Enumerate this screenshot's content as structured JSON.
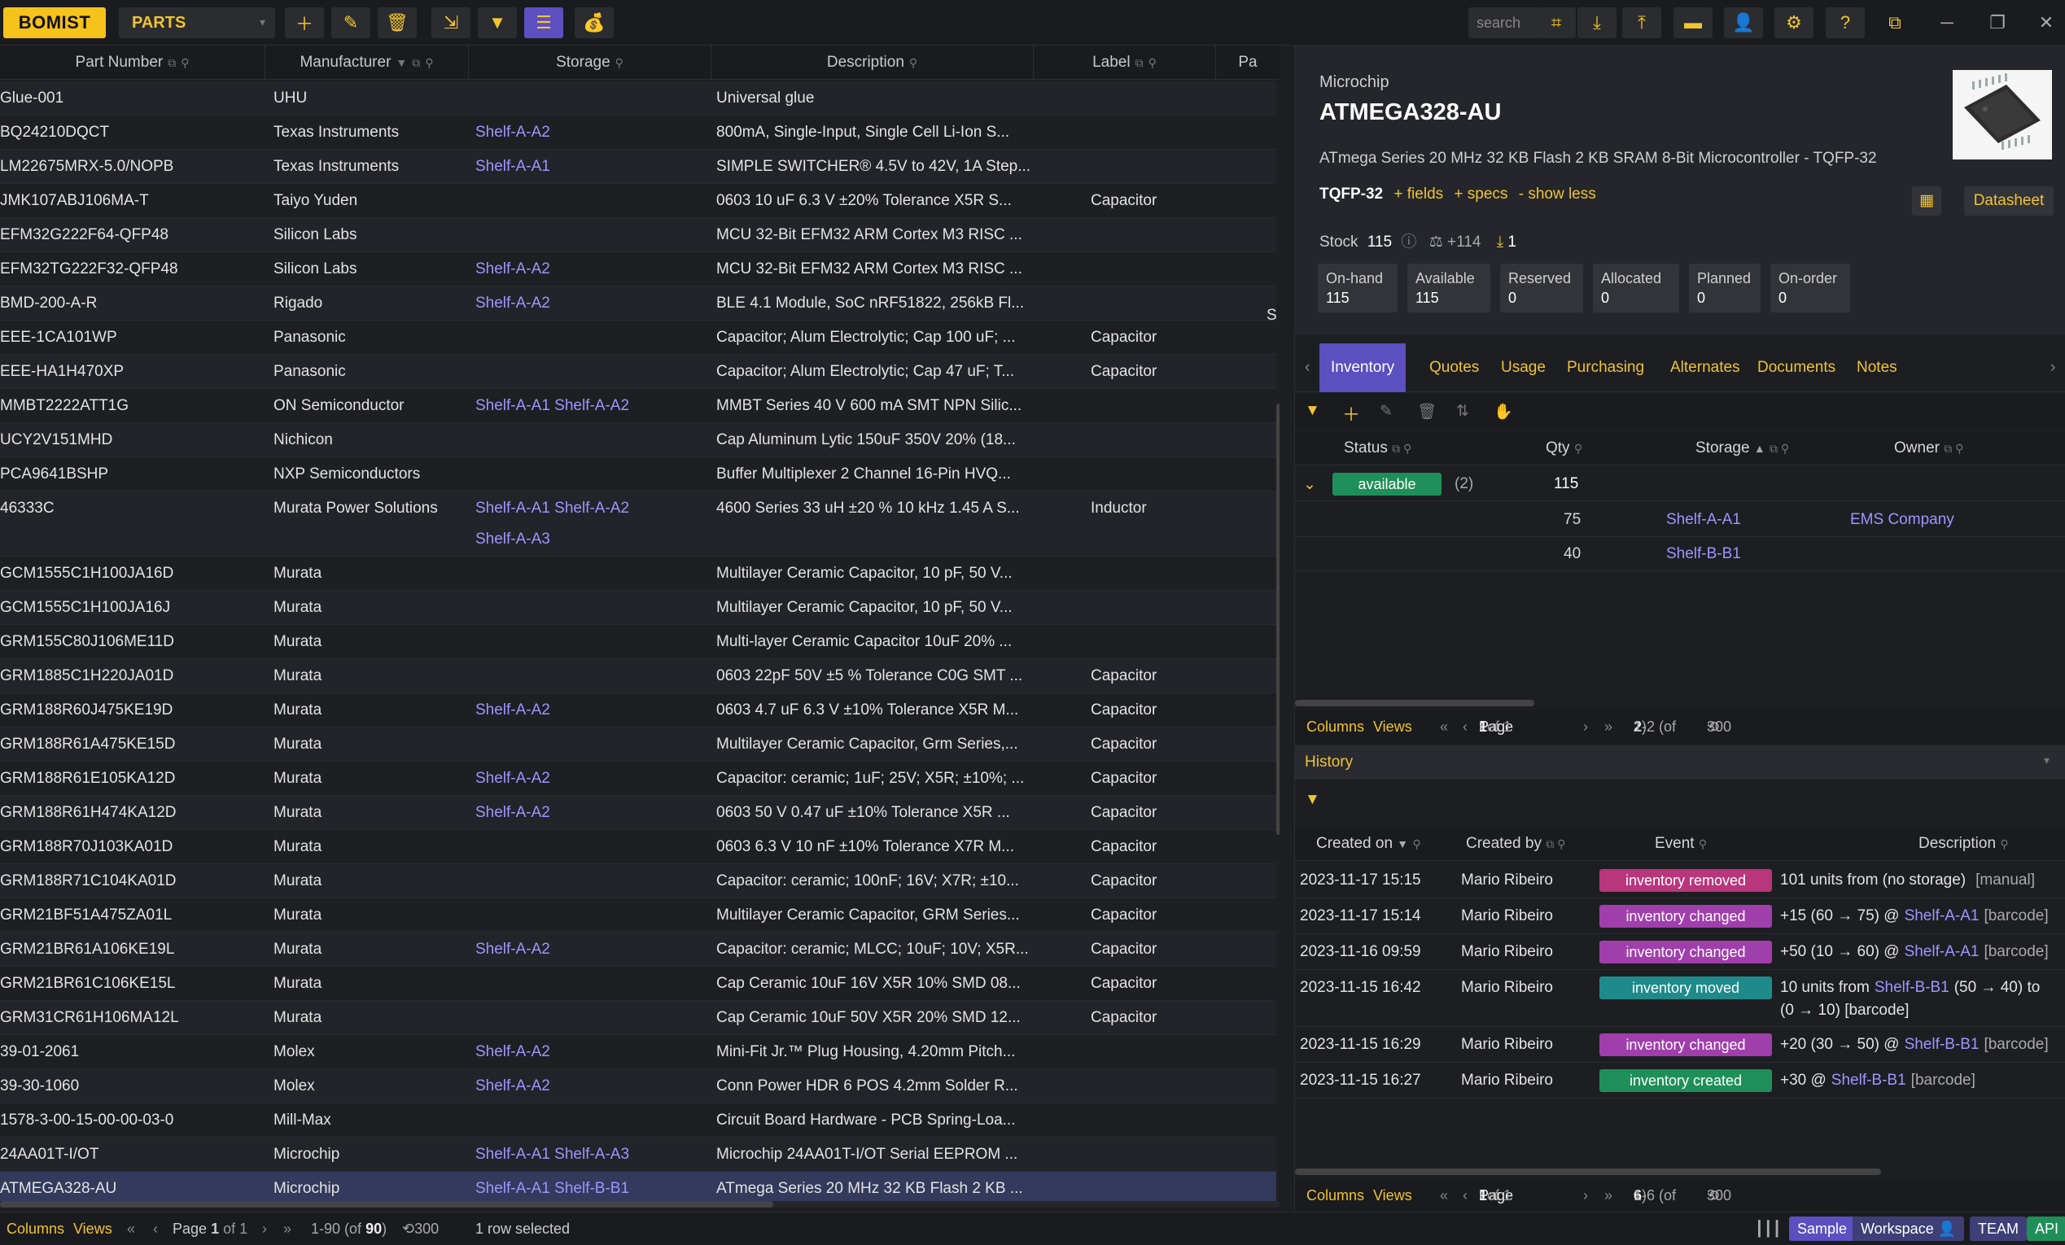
{
  "app": {
    "logo": "BOMIST",
    "module": "PARTS",
    "search_placeholder": "search"
  },
  "grid": {
    "columns": [
      "Part Number",
      "Manufacturer",
      "Storage",
      "Description",
      "Label",
      "Pa"
    ],
    "rows": [
      {
        "pn": "Glue-001",
        "mf": "UHU",
        "st": "",
        "de": "Universal glue",
        "lb": ""
      },
      {
        "pn": "BQ24210DQCT",
        "mf": "Texas Instruments",
        "st": "Shelf-A-A2",
        "de": "800mA, Single-Input, Single Cell Li-Ion S...",
        "lb": ""
      },
      {
        "pn": "LM22675MRX-5.0/NOPB",
        "mf": "Texas Instruments",
        "st": "Shelf-A-A1",
        "de": "SIMPLE SWITCHER® 4.5V to 42V, 1A Step...",
        "lb": ""
      },
      {
        "pn": "JMK107ABJ106MA-T",
        "mf": "Taiyo Yuden",
        "st": "",
        "de": "0603 10 uF 6.3 V ±20% Tolerance X5R S...",
        "lb": "Capacitor"
      },
      {
        "pn": "EFM32G222F64-QFP48",
        "mf": "Silicon Labs",
        "st": "",
        "de": "MCU 32-Bit EFM32 ARM Cortex M3 RISC ...",
        "lb": ""
      },
      {
        "pn": "EFM32TG222F32-QFP48",
        "mf": "Silicon Labs",
        "st": "Shelf-A-A2",
        "de": "MCU 32-Bit EFM32 ARM Cortex M3 RISC ...",
        "lb": ""
      },
      {
        "pn": "BMD-200-A-R",
        "mf": "Rigado",
        "st": "Shelf-A-A2",
        "de": "BLE 4.1 Module, SoC nRF51822, 256kB Fl...",
        "lb": ""
      },
      {
        "pn": "EEE-1CA101WP",
        "mf": "Panasonic",
        "st": "",
        "de": "Capacitor; Alum Electrolytic; Cap 100 uF; ...",
        "lb": "Capacitor"
      },
      {
        "pn": "EEE-HA1H470XP",
        "mf": "Panasonic",
        "st": "",
        "de": "Capacitor; Alum Electrolytic; Cap 47 uF; T...",
        "lb": "Capacitor"
      },
      {
        "pn": "MMBT2222ATT1G",
        "mf": "ON Semiconductor",
        "st": "Shelf-A-A1  Shelf-A-A2",
        "de": "MMBT Series 40 V 600 mA SMT NPN Silic...",
        "lb": ""
      },
      {
        "pn": "UCY2V151MHD",
        "mf": "Nichicon",
        "st": "",
        "de": "Cap Aluminum Lytic 150uF 350V 20% (18...",
        "lb": ""
      },
      {
        "pn": "PCA9641BSHP",
        "mf": "NXP Semiconductors",
        "st": "",
        "de": "Buffer Multiplexer 2 Channel 16-Pin HVQ...",
        "lb": ""
      },
      {
        "pn": "46333C",
        "mf": "Murata Power Solutions",
        "st": "Shelf-A-A1  Shelf-A-A2",
        "st2": "Shelf-A-A3",
        "de": "4600 Series 33 uH ±20 % 10 kHz 1.45 A S...",
        "lb": "Inductor"
      },
      {
        "pn": "GCM1555C1H100JA16D",
        "mf": "Murata",
        "st": "",
        "de": "Multilayer Ceramic Capacitor, 10 pF, 50 V...",
        "lb": ""
      },
      {
        "pn": "GCM1555C1H100JA16J",
        "mf": "Murata",
        "st": "",
        "de": "Multilayer Ceramic Capacitor, 10 pF, 50 V...",
        "lb": ""
      },
      {
        "pn": "GRM155C80J106ME11D",
        "mf": "Murata",
        "st": "",
        "de": "Multi-layer Ceramic Capacitor 10uF 20% ...",
        "lb": ""
      },
      {
        "pn": "GRM1885C1H220JA01D",
        "mf": "Murata",
        "st": "",
        "de": "0603 22pF 50V ±5 % Tolerance C0G SMT ...",
        "lb": "Capacitor"
      },
      {
        "pn": "GRM188R60J475KE19D",
        "mf": "Murata",
        "st": "Shelf-A-A2",
        "de": "0603 4.7 uF 6.3 V ±10% Tolerance X5R M...",
        "lb": "Capacitor"
      },
      {
        "pn": "GRM188R61A475KE15D",
        "mf": "Murata",
        "st": "",
        "de": "Multilayer Ceramic Capacitor, Grm Series,...",
        "lb": "Capacitor"
      },
      {
        "pn": "GRM188R61E105KA12D",
        "mf": "Murata",
        "st": "Shelf-A-A2",
        "de": "Capacitor: ceramic; 1uF; 25V; X5R; ±10%; ...",
        "lb": "Capacitor"
      },
      {
        "pn": "GRM188R61H474KA12D",
        "mf": "Murata",
        "st": "Shelf-A-A2",
        "de": "0603 50 V 0.47 uF ±10% Tolerance X5R ...",
        "lb": "Capacitor"
      },
      {
        "pn": "GRM188R70J103KA01D",
        "mf": "Murata",
        "st": "",
        "de": "0603 6.3 V 10 nF ±10% Tolerance X7R M...",
        "lb": "Capacitor"
      },
      {
        "pn": "GRM188R71C104KA01D",
        "mf": "Murata",
        "st": "",
        "de": "Capacitor: ceramic; 100nF; 16V; X7R; ±10...",
        "lb": "Capacitor"
      },
      {
        "pn": "GRM21BF51A475ZA01L",
        "mf": "Murata",
        "st": "",
        "de": "Multilayer Ceramic Capacitor, GRM Series...",
        "lb": "Capacitor"
      },
      {
        "pn": "GRM21BR61A106KE19L",
        "mf": "Murata",
        "st": "Shelf-A-A2",
        "de": "Capacitor: ceramic; MLCC; 10uF; 10V; X5R...",
        "lb": "Capacitor"
      },
      {
        "pn": "GRM21BR61C106KE15L",
        "mf": "Murata",
        "st": "",
        "de": "Cap Ceramic 10uF 16V X5R 10% SMD 08...",
        "lb": "Capacitor"
      },
      {
        "pn": "GRM31CR61H106MA12L",
        "mf": "Murata",
        "st": "",
        "de": "Cap Ceramic 10uF 50V X5R 20% SMD 12...",
        "lb": "Capacitor"
      },
      {
        "pn": "39-01-2061",
        "mf": "Molex",
        "st": "Shelf-A-A2",
        "de": "Mini-Fit Jr.™ Plug Housing, 4.20mm Pitch...",
        "lb": ""
      },
      {
        "pn": "39-30-1060",
        "mf": "Molex",
        "st": "Shelf-A-A2",
        "de": "Conn Power HDR 6 POS 4.2mm Solder R...",
        "lb": ""
      },
      {
        "pn": "1578-3-00-15-00-00-03-0",
        "mf": "Mill-Max",
        "st": "",
        "de": "Circuit Board Hardware - PCB Spring-Loa...",
        "lb": ""
      },
      {
        "pn": "24AA01T-I/OT",
        "mf": "Microchip",
        "st": "Shelf-A-A1  Shelf-A-A3",
        "de": "Microchip 24AA01T-I/OT Serial EEPROM ...",
        "lb": ""
      },
      {
        "pn": "ATMEGA328-AU",
        "mf": "Microchip",
        "st": "Shelf-A-A1  Shelf-B-B1",
        "de": "ATmega Series 20 MHz 32 KB Flash 2 KB ...",
        "lb": ""
      }
    ],
    "bmd_extra": "S"
  },
  "statusbar": {
    "columns": "Columns",
    "views": "Views",
    "page_prefix": "Page",
    "page_num": "1",
    "page_of": "of 1",
    "range": "1-90 (of",
    "range_total": "90",
    "range_close": ")",
    "limit": "300",
    "selected": "1 row selected",
    "sample": "Sample",
    "workspace": "Workspace",
    "team": "TEAM",
    "api": "API"
  },
  "detail": {
    "manufacturer": "Microchip",
    "part_number": "ATMEGA328-AU",
    "description": "ATmega Series 20 MHz 32 KB Flash 2 KB SRAM 8-Bit Microcontroller - TQFP-32",
    "package": "TQFP-32",
    "fields_link": "+ fields",
    "specs_link": "+ specs",
    "less_link": "- show less",
    "datasheet": "Datasheet",
    "stock_label": "Stock",
    "stock_value": "115",
    "balance": "+114",
    "download_count": "1",
    "stats": [
      {
        "label": "On-hand",
        "value": "115"
      },
      {
        "label": "Available",
        "value": "115"
      },
      {
        "label": "Reserved",
        "value": "0"
      },
      {
        "label": "Allocated",
        "value": "0"
      },
      {
        "label": "Planned",
        "value": "0"
      },
      {
        "label": "On-order",
        "value": "0"
      }
    ]
  },
  "tabs": [
    "Inventory",
    "Quotes",
    "Usage",
    "Purchasing",
    "Alternates",
    "Documents",
    "Notes"
  ],
  "inventory": {
    "columns": [
      "Status",
      "Qty",
      "Storage",
      "Owner"
    ],
    "group": {
      "status": "available",
      "count": "(2)",
      "qty": "115"
    },
    "rows": [
      {
        "qty": "75",
        "storage": "Shelf-A-A1",
        "owner": "EMS Company"
      },
      {
        "qty": "40",
        "storage": "Shelf-B-B1",
        "owner": ""
      }
    ],
    "pager": {
      "columns": "Columns",
      "views": "Views",
      "page": "Page",
      "num": "1",
      "of": "of 1",
      "range": "1-2 (of",
      "total": "2",
      "close": ")",
      "limit": "300"
    }
  },
  "history": {
    "title": "History",
    "columns": [
      "Created on",
      "Created by",
      "Event",
      "Description"
    ],
    "rows": [
      {
        "date": "2023-11-17 15:15",
        "by": "Mario Ribeiro",
        "event": "inventory removed",
        "type": "removed",
        "d1": "101 units from (no storage)",
        "d2": "",
        "d3": "[manual]"
      },
      {
        "date": "2023-11-17 15:14",
        "by": "Mario Ribeiro",
        "event": "inventory changed",
        "type": "changed",
        "d1": "+15 (60 → 75) @",
        "d2": "Shelf-A-A1",
        "d3": "[barcode]"
      },
      {
        "date": "2023-11-16 09:59",
        "by": "Mario Ribeiro",
        "event": "inventory changed",
        "type": "changed",
        "d1": "+50 (10 → 60) @",
        "d2": "Shelf-A-A1",
        "d3": "[barcode]"
      },
      {
        "date": "2023-11-15 16:42",
        "by": "Mario Ribeiro",
        "event": "inventory moved",
        "type": "moved",
        "d1": "10 units from",
        "d2": "Shelf-B-B1",
        "d3": "(50 → 40) to",
        "d4": "(0 → 10) [barcode]"
      },
      {
        "date": "2023-11-15 16:29",
        "by": "Mario Ribeiro",
        "event": "inventory changed",
        "type": "changed",
        "d1": "+20 (30 → 50) @",
        "d2": "Shelf-B-B1",
        "d3": "[barcode]"
      },
      {
        "date": "2023-11-15 16:27",
        "by": "Mario Ribeiro",
        "event": "inventory created",
        "type": "created",
        "d1": "+30 @",
        "d2": "Shelf-B-B1",
        "d3": "[barcode]"
      }
    ],
    "pager": {
      "columns": "Columns",
      "views": "Views",
      "page": "Page",
      "num": "1",
      "of": "of 1",
      "range": "1-6 (of",
      "total": "6",
      "close": ")",
      "limit": "300"
    }
  }
}
